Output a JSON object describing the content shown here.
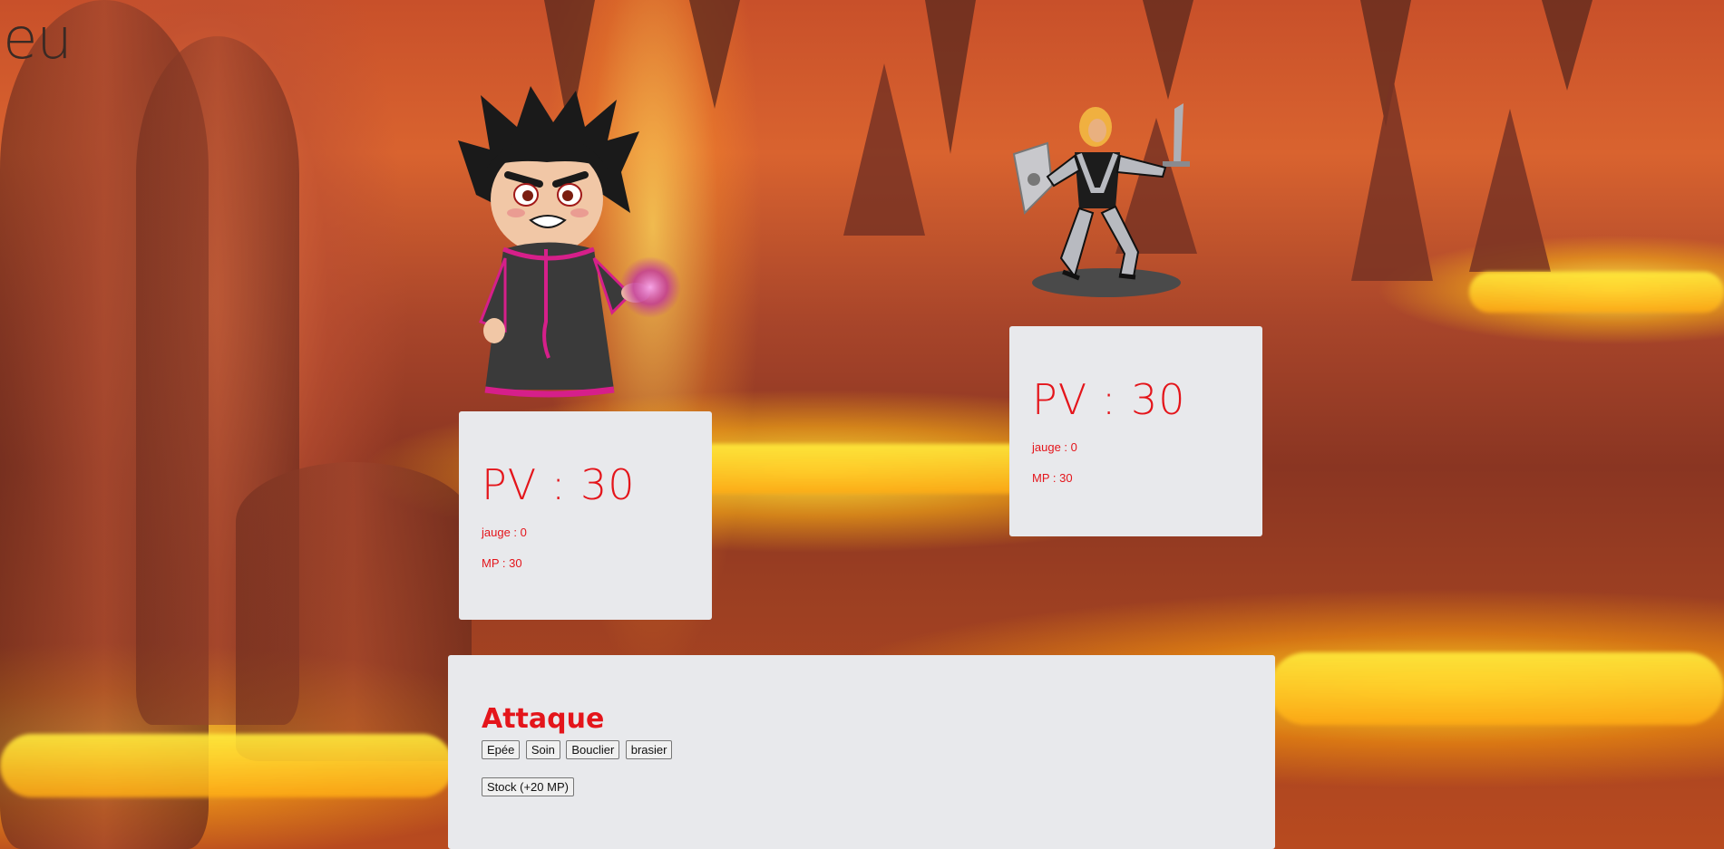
{
  "page": {
    "title": "Jeu"
  },
  "player": {
    "pv_text": "PV : 30",
    "jauge_text": "jauge : 0",
    "mp_text": "MP : 30"
  },
  "enemy": {
    "pv_text": "PV : 30",
    "jauge_text": "jauge : 0",
    "mp_text": "MP : 30"
  },
  "actions": {
    "title": "Attaque",
    "buttons": [
      "Epée",
      "Soin",
      "Bouclier",
      "brasier"
    ],
    "stock_label": "Stock (+20 MP)"
  },
  "colors": {
    "accent": "#e4151b",
    "panel": "#e8e9ec"
  }
}
